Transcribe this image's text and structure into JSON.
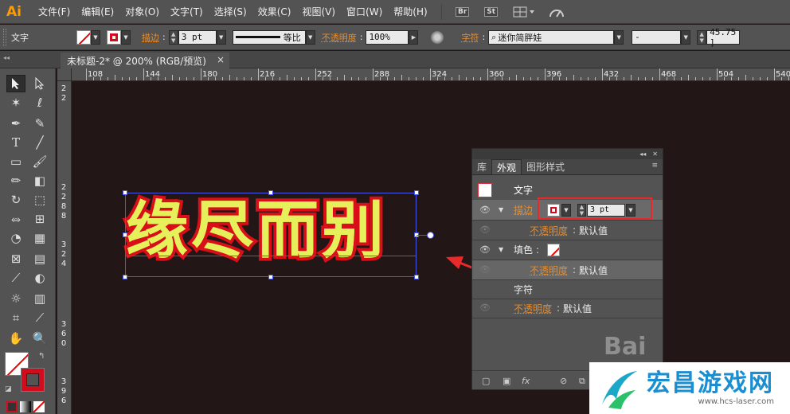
{
  "menubar": {
    "logo": "Ai",
    "items": [
      "文件(F)",
      "编辑(E)",
      "对象(O)",
      "文字(T)",
      "选择(S)",
      "效果(C)",
      "视图(V)",
      "窗口(W)",
      "帮助(H)"
    ],
    "btn_br": "Br",
    "btn_st": "St"
  },
  "control": {
    "mode_label": "文字",
    "stroke_label": "描边",
    "stroke_weight": "3 pt",
    "line_label": "等比",
    "opacity_label": "不透明度",
    "opacity_value": "100%",
    "char_label": "字符",
    "font_name": "迷你简胖娃",
    "font_style": "-",
    "font_size": "45.75 ]"
  },
  "document": {
    "tab_title": "未标题-2* @ 200% (RGB/预览)",
    "close": "×"
  },
  "ruler": {
    "h_labels": [
      "108",
      "144",
      "180",
      "216",
      "252",
      "288",
      "324",
      "360",
      "396",
      "432",
      "468",
      "504",
      "540"
    ],
    "v_labels": [
      "2",
      "2",
      "2",
      "2",
      "8",
      "8",
      "3",
      "2",
      "4",
      "3",
      "6",
      "0",
      "3",
      "9",
      "6"
    ]
  },
  "canvas": {
    "art_text": "缘尽而别"
  },
  "panel": {
    "tabs": [
      "库",
      "外观",
      "图形样式"
    ],
    "active_tab": "外观",
    "rows": {
      "title": "文字",
      "stroke_label": "描边",
      "stroke_weight": "3 pt",
      "opacity_label_1": "不透明度",
      "opacity_value_1": "默认值",
      "fill_label": "填色",
      "opacity_label_2": "不透明度",
      "opacity_value_2": "默认值",
      "char_label": "字符",
      "opacity_label_3": "不透明度",
      "opacity_value_3": "默认值"
    },
    "bottom_fx": "fx"
  },
  "watermark": {
    "brand": "宏昌游戏网",
    "url": "www.hcs-laser.com",
    "baidu": "Bai"
  },
  "colors": {
    "accent_orange": "#e88b2a",
    "stroke_red": "#d80f18",
    "text_fill": "#e6f05a",
    "highlight_red": "#e82a2a",
    "canvas_bg": "#231616"
  }
}
